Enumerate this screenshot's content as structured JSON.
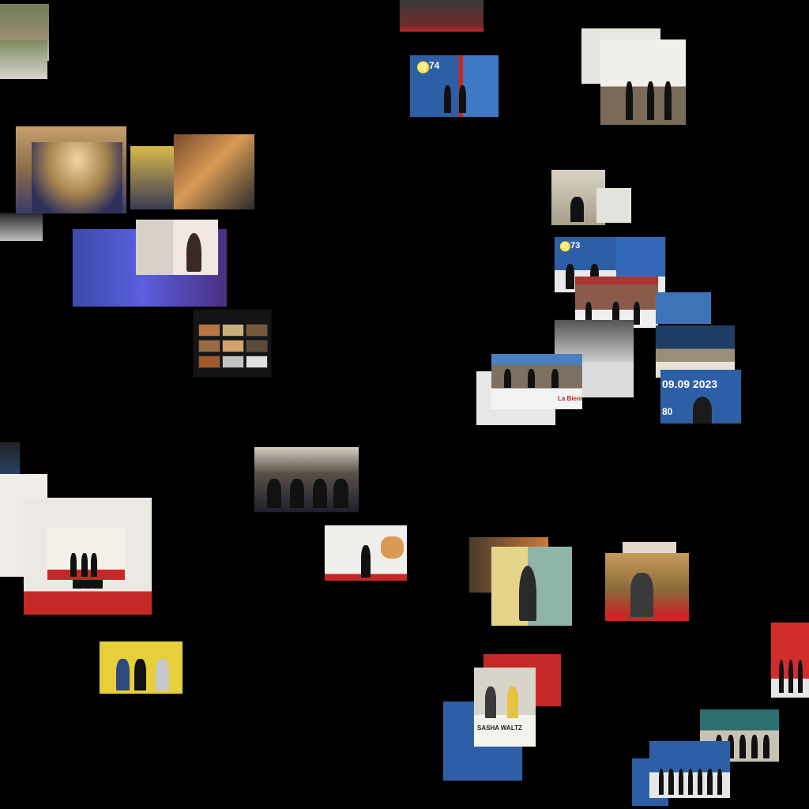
{
  "canvas": {
    "background": "#000000"
  },
  "overlay_texts": {
    "date": "09.09 2023",
    "biennale": "La Biennale di",
    "number_80": "80",
    "number_73": "73",
    "number_74": "74",
    "sasha": "SASHA WALTZ"
  },
  "colors": {
    "festival_blue": "#2d5fa6",
    "carpet_red": "#c62828",
    "warm_gold": "#d8b94a",
    "wall_white": "#ece9e4"
  }
}
